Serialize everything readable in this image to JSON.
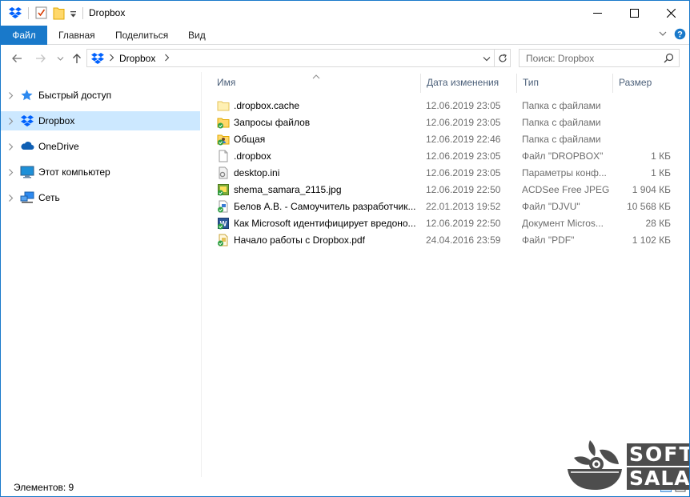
{
  "window": {
    "title": "Dropbox",
    "accent": "#1979ca",
    "selection": "#cce8ff"
  },
  "quick_access_icons": [
    "dropbox-icon",
    "properties-icon",
    "new-folder-icon",
    "customize-dropdown-icon"
  ],
  "ribbon": {
    "tabs": [
      "Файл",
      "Главная",
      "Поделиться",
      "Вид"
    ]
  },
  "address": {
    "path": "Dropbox",
    "search_placeholder": "Поиск: Dropbox"
  },
  "nav": {
    "items": [
      {
        "label": "Быстрый доступ",
        "icon": "star-icon"
      },
      {
        "label": "Dropbox",
        "icon": "dropbox-icon",
        "selected": true
      },
      {
        "label": "OneDrive",
        "icon": "cloud-icon"
      },
      {
        "label": "Этот компьютер",
        "icon": "computer-icon"
      },
      {
        "label": "Сеть",
        "icon": "network-icon"
      }
    ]
  },
  "columns": {
    "name": "Имя",
    "date": "Дата изменения",
    "type": "Тип",
    "size": "Размер"
  },
  "files": [
    {
      "name": ".dropbox.cache",
      "date": "12.06.2019 23:05",
      "type": "Папка с файлами",
      "size": "",
      "icon": "folder-icon"
    },
    {
      "name": "Запросы файлов",
      "date": "12.06.2019 23:05",
      "type": "Папка с файлами",
      "size": "",
      "icon": "synced-folder-icon"
    },
    {
      "name": "Общая",
      "date": "12.06.2019 22:46",
      "type": "Папка с файлами",
      "size": "",
      "icon": "shared-folder-icon"
    },
    {
      "name": ".dropbox",
      "date": "12.06.2019 23:05",
      "type": "Файл \"DROPBOX\"",
      "size": "1 КБ",
      "icon": "blank-file-icon"
    },
    {
      "name": "desktop.ini",
      "date": "12.06.2019 23:05",
      "type": "Параметры конф...",
      "size": "1 КБ",
      "icon": "settings-file-icon"
    },
    {
      "name": "shema_samara_2115.jpg",
      "date": "12.06.2019 22:50",
      "type": "ACDSee Free JPEG...",
      "size": "1 904 КБ",
      "icon": "image-file-icon"
    },
    {
      "name": "Белов А.В. - Самоучитель разработчик...",
      "date": "22.01.2013 19:52",
      "type": "Файл \"DJVU\"",
      "size": "10 568 КБ",
      "icon": "djvu-file-icon"
    },
    {
      "name": "Как Microsoft идентифицирует вредоно...",
      "date": "12.06.2019 22:50",
      "type": "Документ Micros...",
      "size": "28 КБ",
      "icon": "word-file-icon"
    },
    {
      "name": "Начало работы с Dropbox.pdf",
      "date": "24.04.2016 23:59",
      "type": "Файл \"PDF\"",
      "size": "1 102 КБ",
      "icon": "pdf-file-icon"
    }
  ],
  "status": {
    "count_text": "Элементов: 9"
  },
  "watermark": {
    "line1": "SOFT",
    "line2": "SALAD"
  }
}
